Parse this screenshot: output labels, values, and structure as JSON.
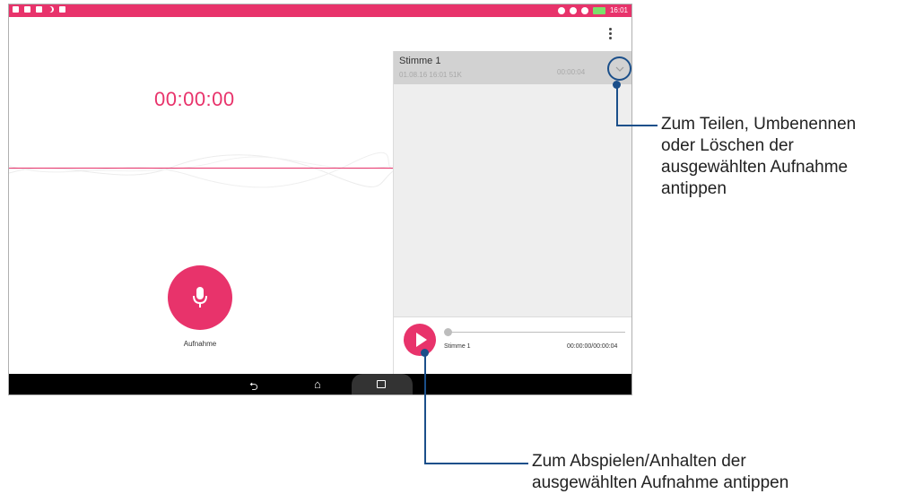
{
  "status_bar": {
    "time": "16:01"
  },
  "recorder": {
    "timer": "00:00:00",
    "record_label": "Aufnahme"
  },
  "recordings": {
    "items": [
      {
        "name": "Stimme 1",
        "meta": "01.08.16 16:01  51K",
        "duration": "00:00:04"
      }
    ]
  },
  "player": {
    "title": "Stimme 1",
    "time": "00:00:00/00:00:04"
  },
  "callouts": {
    "expand_text": "Zum Teilen, Umbenennen\noder Löschen der\nausgewählten Aufnahme\nantippen",
    "play_text": "Zum Abspielen/Anhalten der\nausgewählten Aufnahme antippen"
  },
  "colors": {
    "accent": "#e8336b",
    "callout": "#1b4f8a"
  }
}
